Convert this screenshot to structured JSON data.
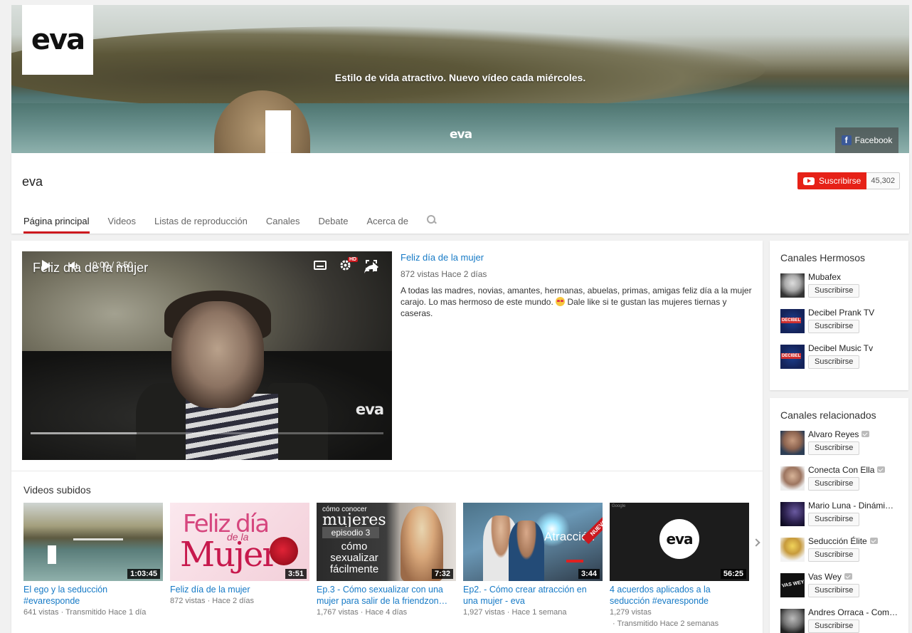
{
  "banner": {
    "logo_text": "eva",
    "tagline": "Estilo de vida atractivo. Nuevo vídeo cada miércoles.",
    "watermark": "eva",
    "facebook_label": "Facebook"
  },
  "channel": {
    "name": "eva",
    "subscribe_label": "Suscribirse",
    "subscriber_count": "45,302",
    "tabs": [
      {
        "label": "Página principal",
        "active": true
      },
      {
        "label": "Videos"
      },
      {
        "label": "Listas de reproducción"
      },
      {
        "label": "Canales"
      },
      {
        "label": "Debate"
      },
      {
        "label": "Acerca de"
      }
    ]
  },
  "featured": {
    "player_title": "Feliz día de la mujer",
    "watermark": "eva",
    "time": "0:00 / 3:50",
    "hd_badge": "HD",
    "progress": 0,
    "title": "Feliz día de la mujer",
    "meta": "872 vistas  Hace 2 días",
    "description_before_emoji": "A todas las madres, novias, amantes, hermanas, abuelas, primas, amigas feliz día a la mujer carajo. Lo mas hermoso de este mundo. ",
    "description_after_emoji": " Dale like si te gustan las mujeres tiernas y caseras."
  },
  "uploads": {
    "section_title": "Videos subidos",
    "videos": [
      {
        "title": "El ego y la seducción #evaresponde",
        "duration": "1:03:45",
        "meta": "641 vistas  ·  Transmitido Hace 1 día"
      },
      {
        "title": "Feliz día de la mujer",
        "duration": "3:51",
        "meta": "872 vistas  ·  Hace 2 días"
      },
      {
        "title": "Ep.3 - Cómo sexualizar con una mujer para salir de la friendzon…",
        "duration": "7:32",
        "meta": "1,767 vistas  ·  Hace 4 días"
      },
      {
        "title": "Ep2. - Cómo crear atracción en una mujer - eva",
        "duration": "3:44",
        "meta": "1,927 vistas  ·  Hace 1 semana"
      },
      {
        "title": "4 acuerdos aplicados a la seducción #evaresponde",
        "duration": "56:25",
        "meta": "1,279 vistas",
        "meta2": "·  Transmitido Hace 2 semanas"
      }
    ],
    "thumb_text": {
      "t2_line1": "Feliz día",
      "t2_line2": "de la",
      "t2_line3": "Mujer",
      "t3_line1": "cómo conocer",
      "t3_line2": "mujeres",
      "t3_line3": "episodio 3",
      "t3_line4": "cómo sexualizar fácilmente",
      "t4_word": "Atracción",
      "t4_badge": "NUEVO!",
      "t5_logo": "eva",
      "t5_corner": "Google"
    }
  },
  "sidebar": {
    "hermosos_title": "Canales Hermosos",
    "hermosos": [
      {
        "name": "Mubafex",
        "button": "Suscribirse"
      },
      {
        "name": "Decibel Prank TV",
        "button": "Suscribirse"
      },
      {
        "name": "Decibel Music Tv",
        "button": "Suscribirse"
      }
    ],
    "relacionados_title": "Canales relacionados",
    "relacionados": [
      {
        "name": "Alvaro Reyes",
        "button": "Suscribirse",
        "verified": true
      },
      {
        "name": "Conecta Con Ella",
        "button": "Suscribirse",
        "verified": true
      },
      {
        "name": "Mario Luna - Dinámi…",
        "button": "Suscribirse"
      },
      {
        "name": "Seducción Élite",
        "button": "Suscribirse",
        "verified": true
      },
      {
        "name": "Vas Wey",
        "button": "Suscribirse",
        "verified": true
      },
      {
        "name": "Andres Orraca - Com…",
        "button": "Suscribirse"
      }
    ]
  }
}
